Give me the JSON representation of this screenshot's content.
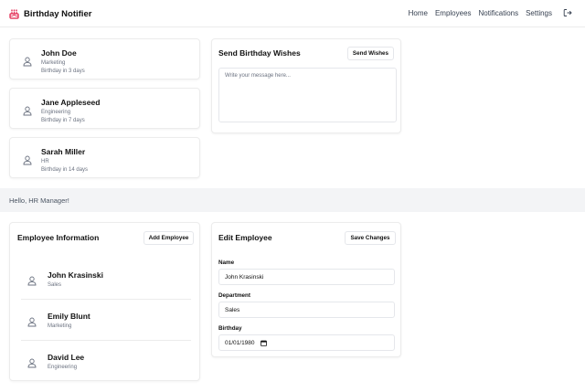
{
  "app": {
    "title": "Birthday Notifier"
  },
  "nav": {
    "items": [
      "Home",
      "Employees",
      "Notifications",
      "Settings"
    ]
  },
  "upcoming": [
    {
      "name": "John Doe",
      "department": "Marketing",
      "birthday": "Birthday in 3 days"
    },
    {
      "name": "Jane Appleseed",
      "department": "Engineering",
      "birthday": "Birthday in 7 days"
    },
    {
      "name": "Sarah Miller",
      "department": "HR",
      "birthday": "Birthday in 14 days"
    }
  ],
  "wishes": {
    "title": "Send Birthday Wishes",
    "button": "Send Wishes",
    "placeholder": "Write your message here..."
  },
  "greeting": "Hello, HR Manager!",
  "employee_info": {
    "title": "Employee Information",
    "add_button": "Add Employee",
    "employees": [
      {
        "name": "John Krasinski",
        "department": "Sales"
      },
      {
        "name": "Emily Blunt",
        "department": "Marketing"
      },
      {
        "name": "David Lee",
        "department": "Engineering"
      }
    ]
  },
  "edit": {
    "title": "Edit Employee",
    "save_button": "Save Changes",
    "name_label": "Name",
    "name_value": "John Krasinski",
    "department_label": "Department",
    "department_value": "Sales",
    "birthday_label": "Birthday",
    "birthday_value": "01/01/1980"
  },
  "colors": {
    "brand_icon": "#e11d48",
    "accent_bg": "#f3f4f6"
  }
}
